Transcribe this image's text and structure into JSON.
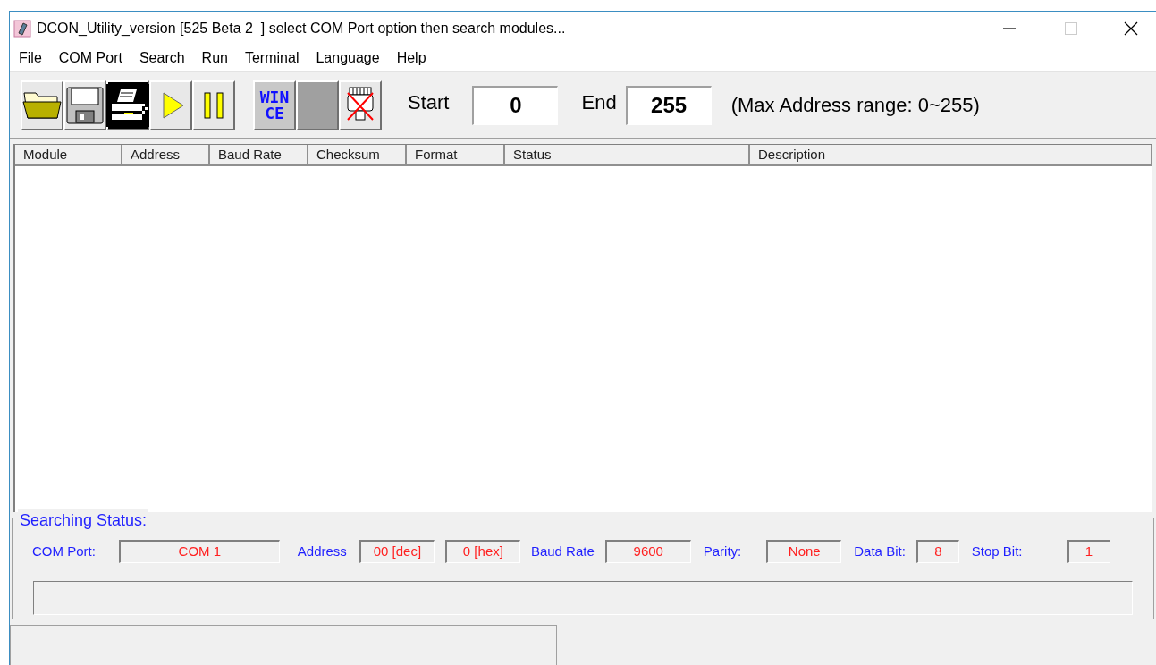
{
  "window": {
    "title": "DCON_Utility_version [525 Beta 2  ] select COM Port option then search modules..."
  },
  "menu": [
    "File",
    "COM Port",
    "Search",
    "Run",
    "Terminal",
    "Language",
    "Help"
  ],
  "toolbar": [
    {
      "kind": "folder"
    },
    {
      "kind": "save"
    },
    {
      "kind": "printer"
    },
    {
      "kind": "play"
    },
    {
      "kind": "pause"
    },
    {
      "kind": "wince",
      "lines": [
        "WIN",
        "CE"
      ]
    },
    {
      "kind": "blank"
    },
    {
      "kind": "unplug"
    }
  ],
  "range": {
    "start_label": "Start",
    "start": "0",
    "end_label": "End",
    "end": "255",
    "note": "(Max Address range: 0~255)"
  },
  "table": {
    "columns": [
      "Module",
      "Address",
      "Baud Rate",
      "Checksum",
      "Format",
      "Status",
      "Description"
    ]
  },
  "searching_status": {
    "title": "Searching Status:",
    "fields": [
      {
        "label": "COM Port:",
        "values": [
          "COM 1"
        ]
      },
      {
        "label": "Address",
        "values": [
          "00 [dec]",
          "0 [hex]"
        ]
      },
      {
        "label": "Baud Rate",
        "values": [
          "9600"
        ]
      },
      {
        "label": "Parity:",
        "values": [
          "None"
        ]
      },
      {
        "label": "Data Bit:",
        "values": [
          "8"
        ]
      },
      {
        "label": "Stop Bit:",
        "values": [
          "1"
        ]
      }
    ]
  }
}
